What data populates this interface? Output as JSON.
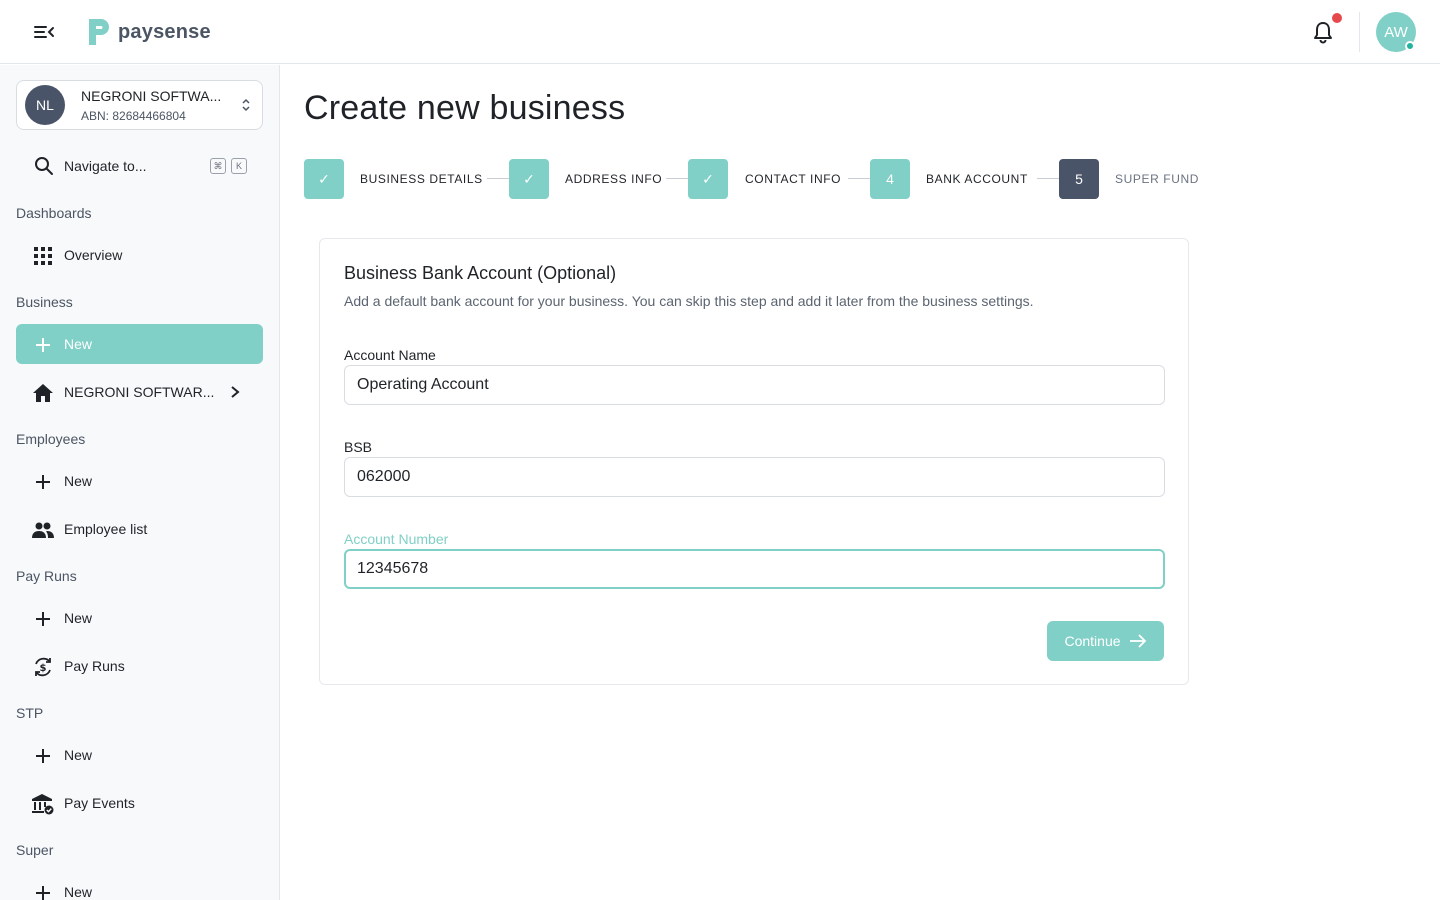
{
  "app": {
    "logo_text": "paysense",
    "user_initials": "AW",
    "accent_color": "#80d0c7",
    "dark_color": "#4a5468",
    "notification_dot_color": "#e5484d"
  },
  "business_switcher": {
    "initials": "NL",
    "name": "NEGRONI SOFTWA...",
    "abn": "ABN: 82684466804"
  },
  "search": {
    "label": "Navigate to...",
    "shortcut_keys": [
      "⌘",
      "K"
    ]
  },
  "sidebar": {
    "sections": [
      {
        "label": "Dashboards",
        "items": [
          {
            "label": "Overview",
            "icon": "grid-icon"
          }
        ]
      },
      {
        "label": "Business",
        "items": [
          {
            "label": "New",
            "icon": "plus-icon",
            "active": true
          },
          {
            "label": "NEGRONI SOFTWAR...",
            "icon": "home-icon"
          }
        ]
      },
      {
        "label": "Employees",
        "items": [
          {
            "label": "New",
            "icon": "plus-icon"
          },
          {
            "label": "Employee list",
            "icon": "people-icon"
          }
        ]
      },
      {
        "label": "Pay Runs",
        "items": [
          {
            "label": "New",
            "icon": "plus-icon"
          },
          {
            "label": "Pay Runs",
            "icon": "currency-cycle-icon"
          }
        ]
      },
      {
        "label": "STP",
        "items": [
          {
            "label": "New",
            "icon": "plus-icon"
          },
          {
            "label": "Pay Events",
            "icon": "bank-check-icon"
          }
        ]
      },
      {
        "label": "Super",
        "items": [
          {
            "label": "New",
            "icon": "plus-icon"
          }
        ]
      }
    ]
  },
  "page": {
    "title": "Create new business"
  },
  "stepper": {
    "steps": [
      {
        "label": "BUSINESS DETAILS",
        "status": "done",
        "marker": "✓"
      },
      {
        "label": "ADDRESS INFO",
        "status": "done",
        "marker": "✓"
      },
      {
        "label": "CONTACT INFO",
        "status": "done",
        "marker": "✓"
      },
      {
        "label": "BANK ACCOUNT",
        "status": "current",
        "marker": "4"
      },
      {
        "label": "SUPER FUND",
        "status": "todo",
        "marker": "5"
      }
    ]
  },
  "form": {
    "title": "Business Bank Account (Optional)",
    "subtitle": "Add a default bank account for your business. You can skip this step and add it later from the business settings.",
    "account_name_label": "Account Name",
    "account_name_value": "Operating Account",
    "bsb_label": "BSB",
    "bsb_value": "062000",
    "account_number_label": "Account Number",
    "account_number_value": "12345678",
    "continue_label": "Continue"
  }
}
